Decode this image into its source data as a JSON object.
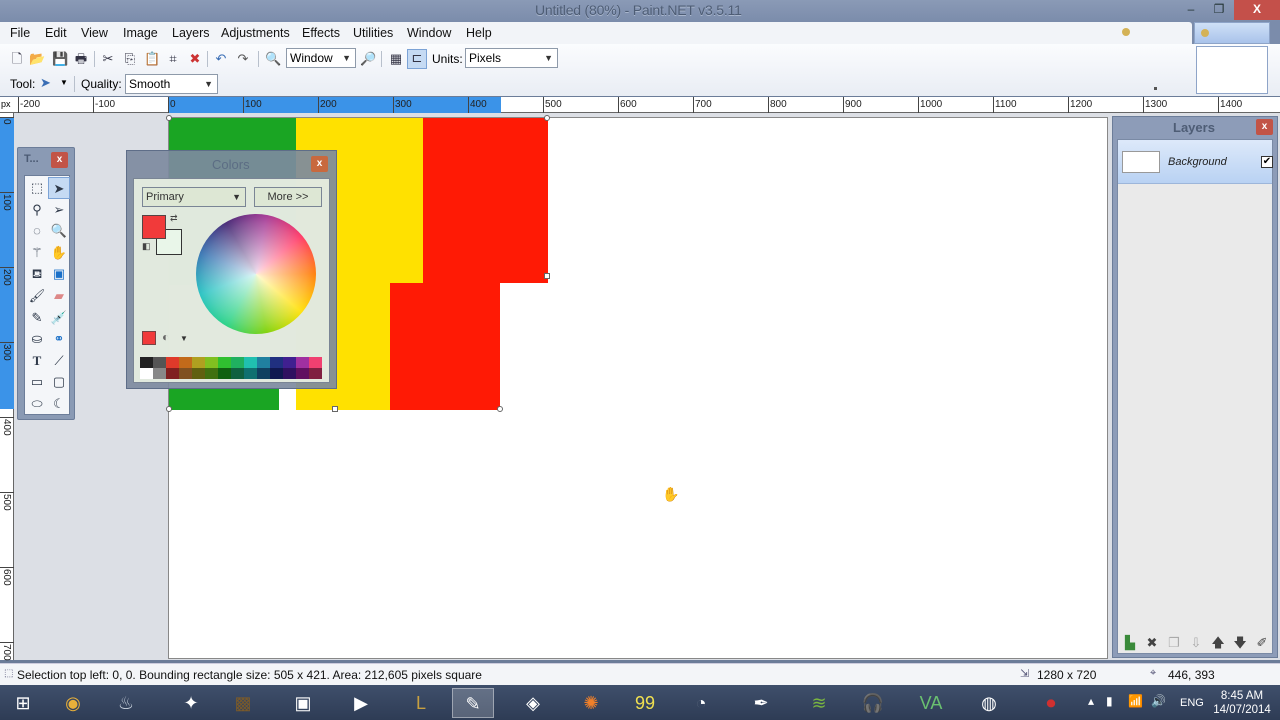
{
  "window": {
    "title": "Untitled (80%) - Paint.NET v3.5.11",
    "minimize_label": "–",
    "maximize_label": "❐",
    "close_label": "X"
  },
  "menu": [
    "File",
    "Edit",
    "View",
    "Image",
    "Layers",
    "Adjustments",
    "Effects",
    "Utilities",
    "Window",
    "Help"
  ],
  "toolbar": {
    "zoom_value": "Window",
    "units_label": "Units:",
    "units_value": "Pixels",
    "tool_label": "Tool:",
    "quality_label": "Quality:",
    "quality_value": "Smooth",
    "icons": [
      "new-icon",
      "open-icon",
      "save-icon",
      "print-icon",
      "cut-icon",
      "copy-icon",
      "paste-icon",
      "crop-icon",
      "deselect-icon",
      "undo-icon",
      "redo-icon",
      "zoom-out-icon",
      "zoom-in-icon",
      "grid-icon",
      "ruler-icon"
    ]
  },
  "ruler": {
    "unit_label": "px",
    "h_labels": [
      "-200",
      "-100",
      "0",
      "100",
      "200",
      "300",
      "400",
      "500",
      "600",
      "700",
      "800",
      "900",
      "1000",
      "1100",
      "1200",
      "1300",
      "1400"
    ],
    "v_labels": [
      "0",
      "100",
      "200",
      "300",
      "400",
      "500",
      "600",
      "700"
    ]
  },
  "tools_window": {
    "title": "T...",
    "close_label": "x",
    "tools": [
      "rectangle-select",
      "move-selection",
      "lasso-select",
      "move-selected",
      "ellipse-select",
      "zoom",
      "magic-wand",
      "pan",
      "paint-bucket",
      "gradient",
      "paintbrush",
      "eraser",
      "pencil",
      "color-picker",
      "clone-stamp",
      "recolor",
      "text",
      "line-curve",
      "rectangle",
      "rounded-rectangle",
      "ellipse",
      "freeform-shape"
    ],
    "active_tool": "move-selection"
  },
  "colors_window": {
    "title": "Colors",
    "close_label": "x",
    "mode": "Primary",
    "more_label": "More >>",
    "primary_color": "#f13a3a",
    "secondary_color": "#ffffff",
    "palette_top": [
      "#222222",
      "#555555",
      "#e03a2a",
      "#c26a1a",
      "#b0a020",
      "#80c020",
      "#30c030",
      "#20b060",
      "#20c0b0",
      "#2080a0",
      "#203080",
      "#402090",
      "#a030a0",
      "#f04070"
    ],
    "palette_bottom": [
      "#ffffff",
      "#888888",
      "#802020",
      "#805020",
      "#606010",
      "#407010",
      "#106010",
      "#106040",
      "#107070",
      "#104060",
      "#101850",
      "#301060",
      "#601060",
      "#802040"
    ]
  },
  "canvas": {
    "blocks": [
      {
        "name": "green-block-top",
        "color": "#1aa523"
      },
      {
        "name": "yellow-block",
        "color": "#ffe100"
      },
      {
        "name": "red-block-top",
        "color": "#ff1a05"
      },
      {
        "name": "red-block-bottom",
        "color": "#ff1a05"
      },
      {
        "name": "green-block-bottom",
        "color": "#1aa523"
      }
    ]
  },
  "layers_window": {
    "title": "Layers",
    "close_label": "x",
    "layers": [
      {
        "name": "Background",
        "visible": true
      }
    ],
    "buttons": [
      "add-layer",
      "delete-layer",
      "duplicate-layer",
      "merge-layer-down",
      "move-layer-up",
      "move-layer-down",
      "layer-properties"
    ]
  },
  "status": {
    "text": "Selection top left: 0, 0. Bounding rectangle size: 505 x 421. Area: 212,605 pixels square",
    "image_size": "1280 x 720",
    "cursor_position": "446, 393"
  },
  "taskbar": {
    "apps": [
      "windows-start",
      "chrome",
      "steam",
      "app-4",
      "minecraft",
      "monitor-app",
      "media-player",
      "league-of-legends",
      "paint-net",
      "unity",
      "blender",
      "app-99",
      "gimp",
      "inkscape",
      "spotify",
      "audacity",
      "app-va",
      "vlc-like",
      "recorder"
    ],
    "active_app": "paint-net",
    "language": "ENG",
    "time": "8:45 AM",
    "date": "14/07/2014"
  }
}
